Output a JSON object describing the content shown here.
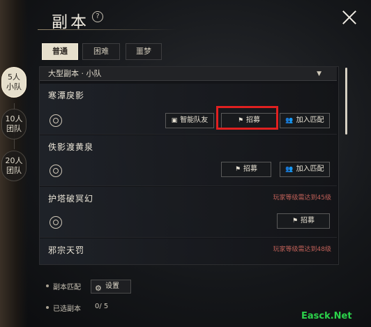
{
  "header": {
    "title": "副本",
    "help": "?"
  },
  "difficulty_tabs": [
    {
      "label": "普通",
      "active": true
    },
    {
      "label": "困难",
      "active": false
    },
    {
      "label": "噩梦",
      "active": false
    }
  ],
  "party_tabs": [
    {
      "line1": "5人",
      "line2": "小队",
      "active": true
    },
    {
      "line1": "10人",
      "line2": "团队",
      "active": false
    },
    {
      "line1": "20人",
      "line2": "团队",
      "active": false
    }
  ],
  "dropdown": {
    "label": "大型副本 · 小队",
    "arrow": "▼"
  },
  "dungeons": [
    {
      "name": "寒潭戾影",
      "buttons": [
        "智能队友",
        "招募",
        "加入匹配"
      ],
      "requirement": ""
    },
    {
      "name": "佚影渡黄泉",
      "buttons": [
        "招募",
        "加入匹配"
      ],
      "requirement": ""
    },
    {
      "name": "护塔破冥幻",
      "buttons": [
        "招募"
      ],
      "requirement": "玩家等级需达到45级"
    },
    {
      "name": "邪宗天罚",
      "buttons": [],
      "requirement": "玩家等级需达到48级"
    }
  ],
  "footer": {
    "match_label": "副本匹配",
    "settings_label": "设置",
    "selected_label": "已选副本",
    "selected_value": "0/ 5"
  },
  "watermark": "Easck.Net",
  "colors": {
    "accent": "#e6dfcc",
    "highlight": "#e02020",
    "requirement": "#c06058",
    "watermark": "#2bd24a"
  }
}
